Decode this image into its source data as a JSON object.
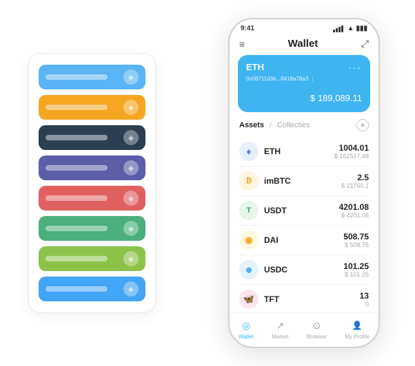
{
  "scene": {
    "left_panel": {
      "cards": [
        {
          "color": "card-blue",
          "icon": "◈"
        },
        {
          "color": "card-orange",
          "icon": "◈"
        },
        {
          "color": "card-dark",
          "icon": "◈"
        },
        {
          "color": "card-purple",
          "icon": "◈"
        },
        {
          "color": "card-red",
          "icon": "◈"
        },
        {
          "color": "card-green",
          "icon": "◈"
        },
        {
          "color": "card-lightgreen",
          "icon": "◈"
        },
        {
          "color": "card-lightblue",
          "icon": "◈"
        }
      ]
    },
    "phone": {
      "status_bar": {
        "time": "9:41",
        "wifi": "wifi",
        "battery": "battery"
      },
      "header": {
        "menu_icon": "≡",
        "title": "Wallet",
        "expand_icon": "⤢"
      },
      "eth_card": {
        "label": "ETH",
        "dots": "···",
        "address": "0x08711d3b...8418a78a3  ⋮",
        "amount_symbol": "$ ",
        "amount": "189,089.11"
      },
      "assets_section": {
        "tab_active": "Assets",
        "divider": "/",
        "tab_inactive": "Collecties",
        "add_icon": "+"
      },
      "assets": [
        {
          "symbol": "ETH",
          "icon": "♦",
          "icon_class": "eth-coin",
          "amount": "1004.01",
          "usd": "$ 162517.48"
        },
        {
          "symbol": "imBTC",
          "icon": "₿",
          "icon_class": "imbtc-coin",
          "amount": "2.5",
          "usd": "$ 21760.1"
        },
        {
          "symbol": "USDT",
          "icon": "T",
          "icon_class": "usdt-coin",
          "amount": "4201.08",
          "usd": "$ 4201.08"
        },
        {
          "symbol": "DAI",
          "icon": "D",
          "icon_class": "dai-coin",
          "amount": "508.75",
          "usd": "$ 508.75"
        },
        {
          "symbol": "USDC",
          "icon": "U",
          "icon_class": "usdc-coin",
          "amount": "101.25",
          "usd": "$ 101.25"
        },
        {
          "symbol": "TFT",
          "icon": "T",
          "icon_class": "tft-coin",
          "amount": "13",
          "usd": "0"
        }
      ],
      "bottom_nav": [
        {
          "label": "Wallet",
          "icon": "◎",
          "active": true
        },
        {
          "label": "Market",
          "icon": "↗",
          "active": false
        },
        {
          "label": "Browser",
          "icon": "⊙",
          "active": false
        },
        {
          "label": "My Profile",
          "icon": "👤",
          "active": false
        }
      ]
    }
  }
}
